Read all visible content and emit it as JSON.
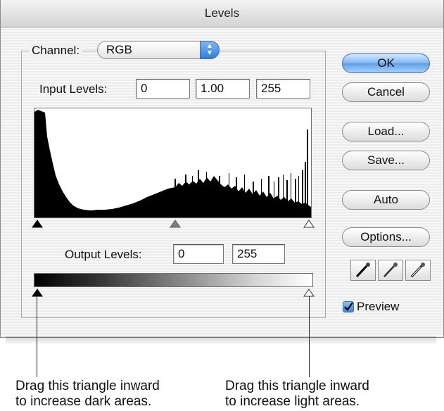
{
  "window": {
    "title": "Levels"
  },
  "channel": {
    "label": "Channel:",
    "value": "RGB"
  },
  "input_levels": {
    "label": "Input Levels:",
    "black": "0",
    "gamma": "1.00",
    "white": "255"
  },
  "output_levels": {
    "label": "Output Levels:",
    "black": "0",
    "white": "255"
  },
  "buttons": {
    "ok": "OK",
    "cancel": "Cancel",
    "load": "Load...",
    "save": "Save...",
    "auto": "Auto",
    "options": "Options..."
  },
  "eyedroppers": [
    "black-eyedropper-icon",
    "gray-eyedropper-icon",
    "white-eyedropper-icon"
  ],
  "preview": {
    "label": "Preview",
    "checked": true
  },
  "callouts": {
    "left": [
      "Drag this triangle inward",
      "to increase dark areas."
    ],
    "right": [
      "Drag this triangle inward",
      "to increase light areas."
    ]
  },
  "colors": {
    "ok_button": "#6aa8ea",
    "histogram": "#000000",
    "accent_blue": "#3a84d6"
  }
}
